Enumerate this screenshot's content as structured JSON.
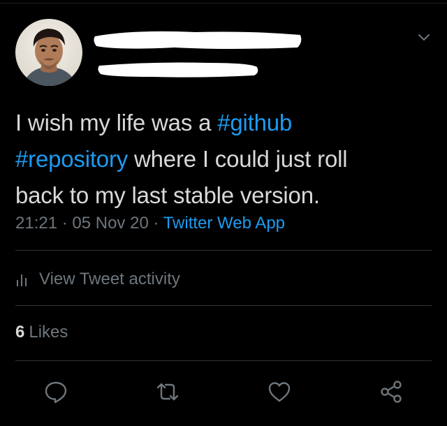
{
  "tweet": {
    "text_line1_prefix": "I wish my life was a ",
    "hashtag_github": "#github",
    "hashtag_repository": "#repository",
    "text_line2_suffix": " where I could just roll",
    "text_line3": "back to my last stable version.",
    "time": "21:21",
    "separator": " · ",
    "date": "05 Nov 20",
    "source": "Twitter Web App"
  },
  "activity": {
    "label": "View Tweet activity"
  },
  "likes": {
    "count": "6",
    "label": "Likes"
  },
  "colors": {
    "background": "#000000",
    "text": "#d9d9d9",
    "secondary": "#6e767d",
    "accent": "#1d9bf0",
    "divider": "#2f3336"
  },
  "icons": {
    "menu": "chevron-down-icon",
    "activity": "bar-chart-icon",
    "reply": "reply-icon",
    "retweet": "retweet-icon",
    "like": "heart-icon",
    "share": "share-icon"
  }
}
